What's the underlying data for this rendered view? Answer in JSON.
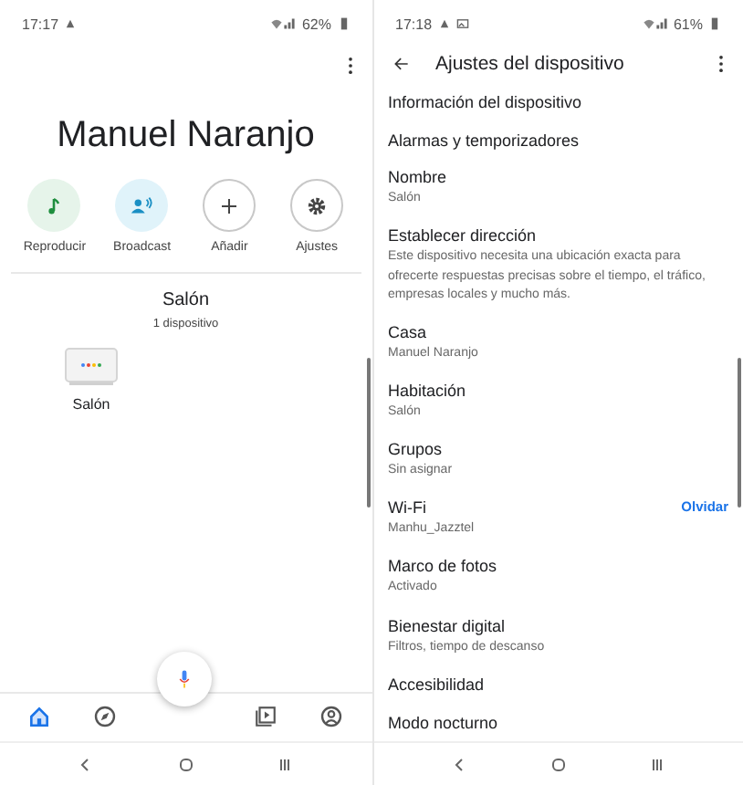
{
  "home_screen": {
    "status_bar": {
      "time": "17:17",
      "battery": "62%"
    },
    "title": "Manuel Naranjo",
    "actions": [
      {
        "kind": "music",
        "label": "Reproducir"
      },
      {
        "kind": "broadcast",
        "label": "Broadcast"
      },
      {
        "kind": "add",
        "label": "Añadir"
      },
      {
        "kind": "settings",
        "label": "Ajustes"
      }
    ],
    "room": {
      "name": "Salón",
      "count": "1 dispositivo"
    },
    "devices": [
      {
        "name": "Salón"
      }
    ],
    "bottom_nav": [
      {
        "kind": "home",
        "selected": true
      },
      {
        "kind": "explore",
        "selected": false
      },
      {
        "kind": "media",
        "selected": false
      },
      {
        "kind": "account",
        "selected": false
      }
    ]
  },
  "settings_screen": {
    "status_bar": {
      "time": "17:18",
      "battery": "61%"
    },
    "title": "Ajustes del dispositivo",
    "items": [
      {
        "kind": "plain",
        "title": "Información del dispositivo"
      },
      {
        "kind": "plain",
        "title": "Alarmas y temporizadores"
      },
      {
        "kind": "detail",
        "title": "Nombre",
        "value": "Salón"
      },
      {
        "kind": "detail",
        "title": "Establecer dirección",
        "value": "Este dispositivo necesita una ubicación exacta para ofrecerte respuestas precisas sobre el tiempo, el tráfico, empresas locales y mucho más."
      },
      {
        "kind": "detail",
        "title": "Casa",
        "value": "Manuel Naranjo"
      },
      {
        "kind": "detail",
        "title": "Habitación",
        "value": "Salón"
      },
      {
        "kind": "detail",
        "title": "Grupos",
        "value": "Sin asignar"
      },
      {
        "kind": "detail",
        "title": "Wi-Fi",
        "value": "Manhu_Jazztel",
        "action": "Olvidar"
      },
      {
        "kind": "detail",
        "title": "Marco de fotos",
        "value": "Activado"
      },
      {
        "kind": "detail",
        "title": "Bienestar digital",
        "value": "Filtros, tiempo de descanso"
      },
      {
        "kind": "plain",
        "title": "Accesibilidad"
      },
      {
        "kind": "plain",
        "title": "Modo nocturno"
      }
    ]
  }
}
